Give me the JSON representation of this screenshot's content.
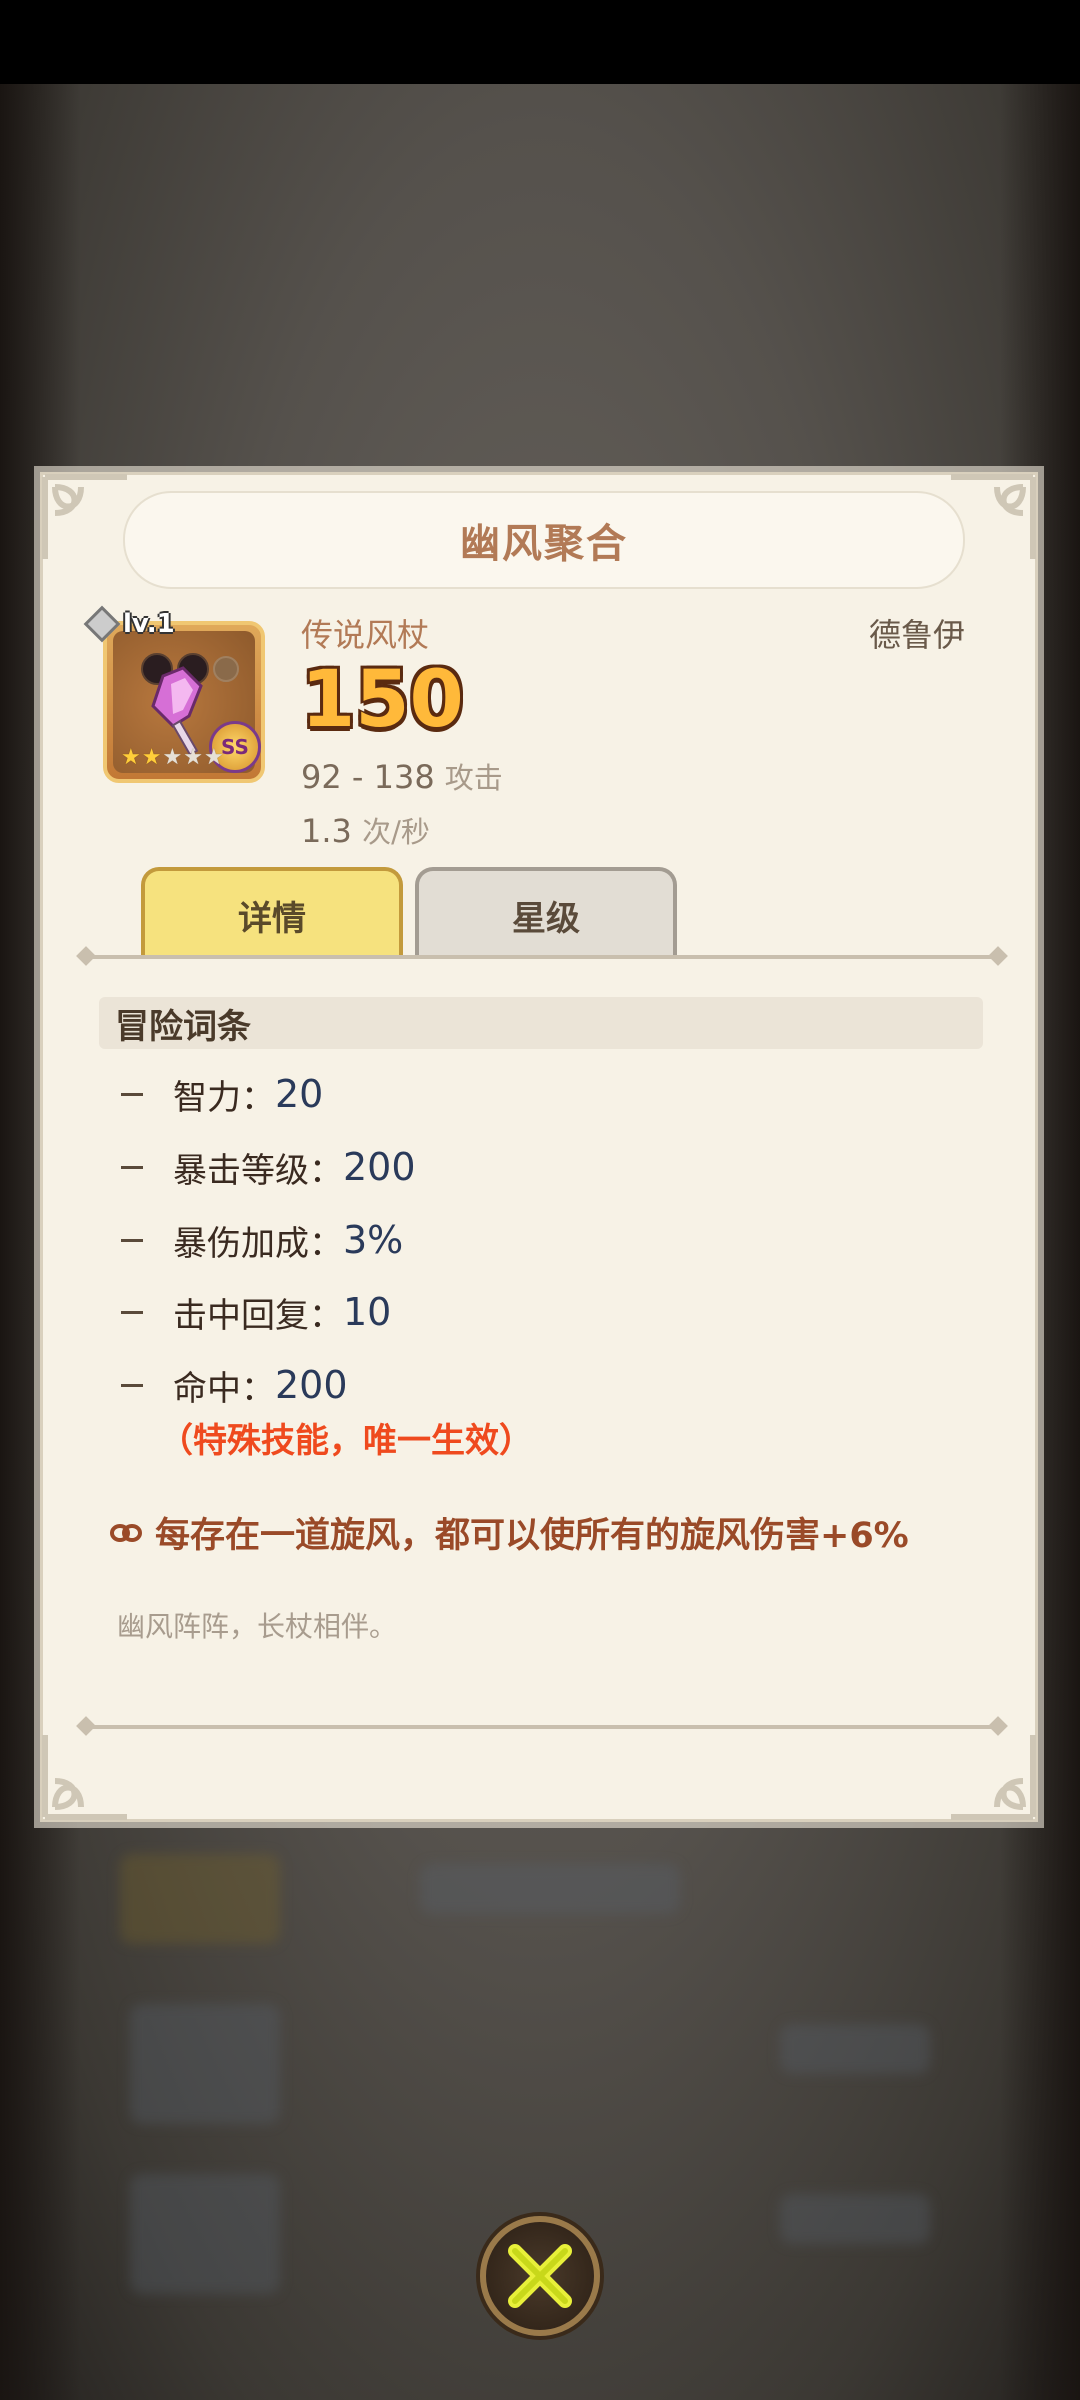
{
  "dialog": {
    "title": "幽风聚合"
  },
  "item": {
    "level": "lv.1",
    "stars_filled": 2,
    "stars_total": 5,
    "rank_badge": "SS",
    "icon": "crystal-staff-icon",
    "name": "传说风杖",
    "class": "德鲁伊",
    "attack_power": "150",
    "attack_range": "92 - 138",
    "attack_unit": "攻击",
    "attack_speed": "1.3",
    "attack_speed_unit": "次/秒"
  },
  "tabs": [
    {
      "label": "详情",
      "active": true
    },
    {
      "label": "星级",
      "active": false
    }
  ],
  "section": {
    "header": "冒险词条",
    "attributes": [
      {
        "label": "智力：",
        "value": "20"
      },
      {
        "label": "暴击等级：",
        "value": "200"
      },
      {
        "label": "暴伤加成：",
        "value": "3%"
      },
      {
        "label": "击中回复：",
        "value": "10"
      },
      {
        "label": "命中：",
        "value": "200"
      }
    ],
    "special_note": "（特殊技能，唯一生效）",
    "effect_text": "每存在一道旋风，都可以使所有的旋风伤害+6%",
    "flavor_text": "幽风阵阵，长杖相伴。"
  },
  "close_button": {
    "icon": "close-x-icon"
  },
  "colors": {
    "title": "#b27a56",
    "attack_gold": "#ffb93a",
    "special_red": "#ef4a1e",
    "effect_brown": "#9a4a28",
    "tab_active": "#f6e27e",
    "tab_inactive": "#e2ddd4"
  }
}
